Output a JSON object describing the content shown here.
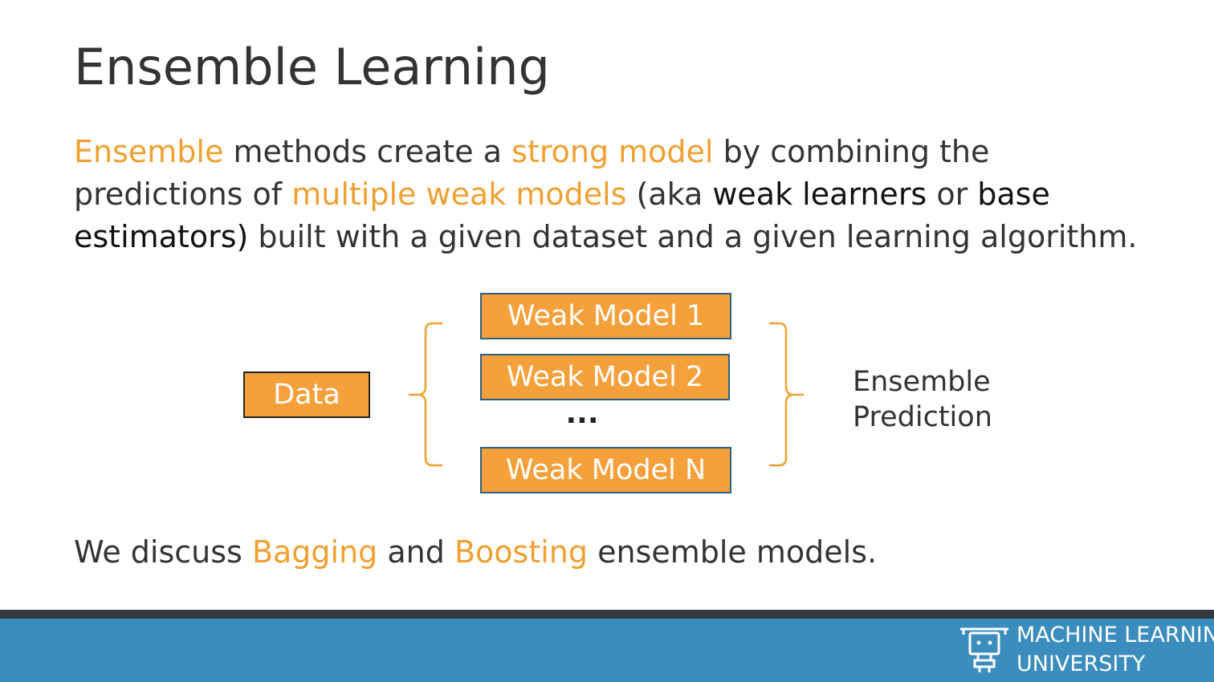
{
  "slide": {
    "title": "Ensemble Learning",
    "intro": {
      "line1": {
        "ensemble": "Ensemble",
        "t1": " methods create a ",
        "strong_model": "strong model",
        "t2": " by combining the"
      },
      "line2": {
        "t1": "predictions of ",
        "multiple_weak_models": "multiple weak models",
        "t2": " (aka ",
        "weak_learners": "weak learners",
        "t3": " or ",
        "base": "base"
      },
      "line3": {
        "estimators": "estimators)",
        "t1": " built with a given dataset and a given learning algorithm."
      }
    },
    "diagram": {
      "data_label": "Data",
      "models": [
        "Weak Model 1",
        "Weak Model 2",
        "Weak Model N"
      ],
      "ellipsis": "...",
      "output_line1": "Ensemble",
      "output_line2": "Prediction"
    },
    "closing": {
      "t1": "We discuss ",
      "bagging": "Bagging",
      "t2": " and ",
      "boosting": "Boosting",
      "t3": " ensemble models."
    }
  },
  "footer": {
    "brand_line1": "MACHINE LEARNING",
    "brand_line2": "UNIVERSITY",
    "logo_icon": "robot-icon"
  },
  "colors": {
    "accent": "#F0A030",
    "box_fill": "#F5A03A",
    "footer_blue": "#3b8dbd",
    "footer_dark": "#333a3d",
    "text": "#333333"
  }
}
